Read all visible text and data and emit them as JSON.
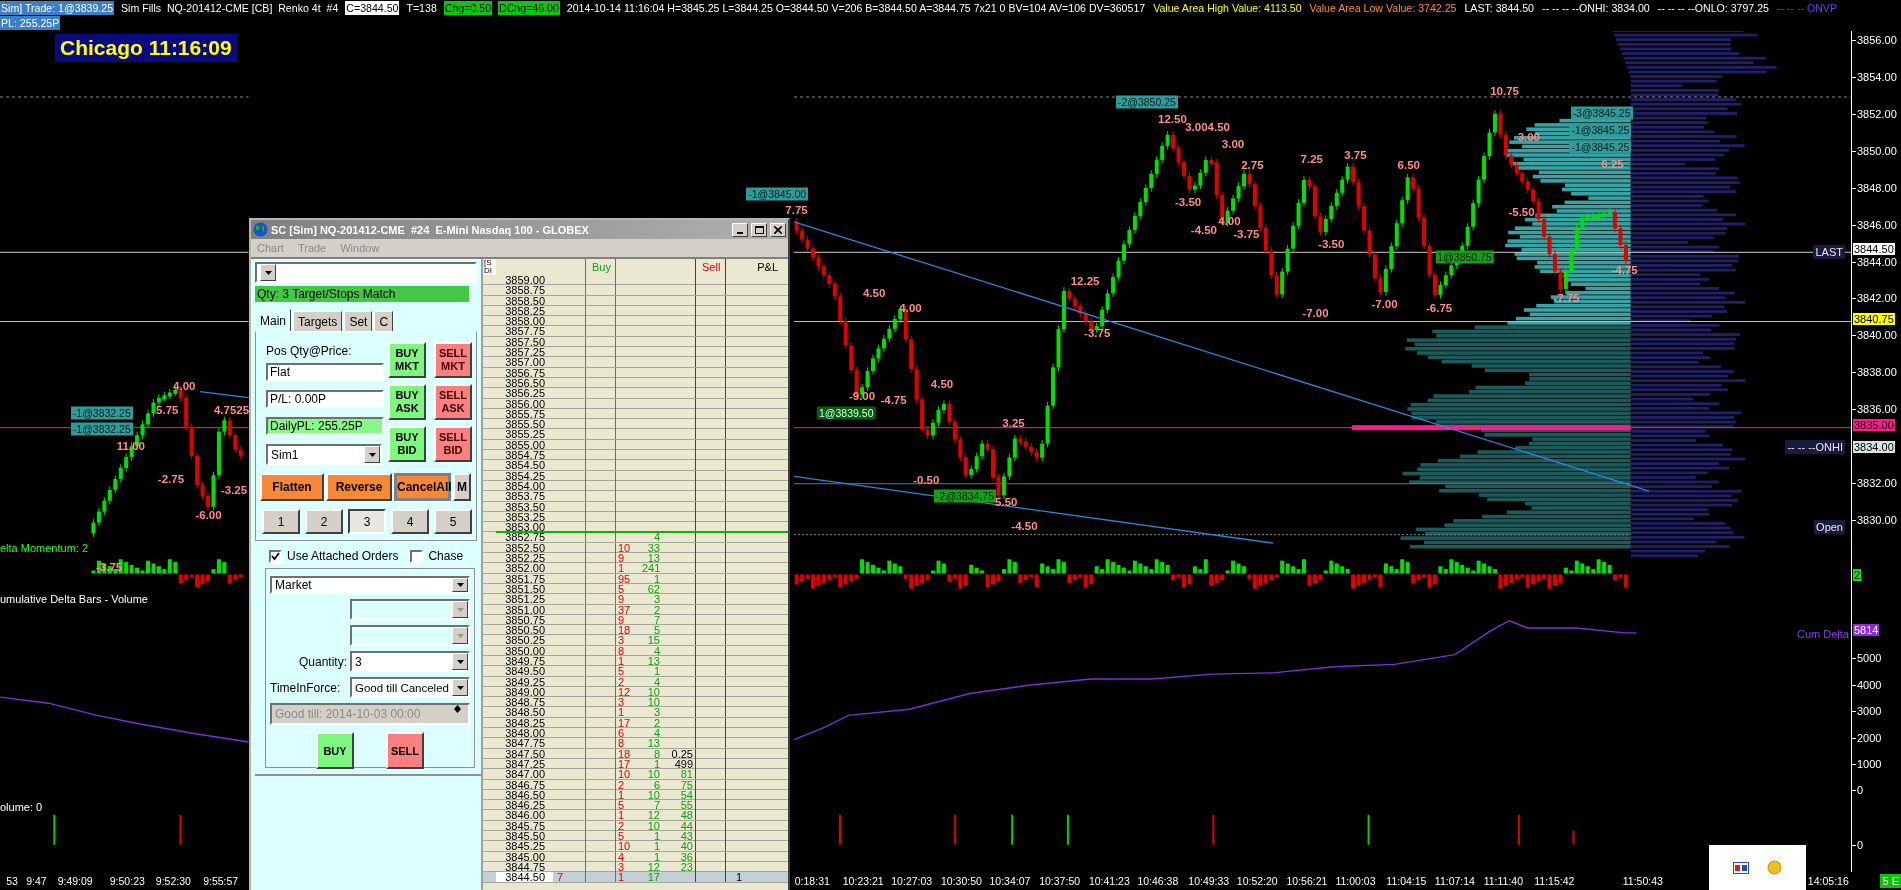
{
  "info_bar": {
    "line_1": [
      {
        "text": "Sim] Trade: 1@3839.25",
        "kind": "blue"
      },
      {
        "text": "Sim Fills  NQ-201412-CME [CB]  Renko 4t  #4",
        "kind": "plain"
      },
      {
        "text": "C=3844.50",
        "kind": "white"
      },
      {
        "text": "T=138",
        "kind": "plain"
      },
      {
        "text": "Chg=0.50",
        "kind": "green"
      },
      {
        "text": "DChg=46.00",
        "kind": "green"
      },
      {
        "text": "2014-10-14 11:16:04 H=3845.25 L=3844.25 O=3844.50 V=206 B=3844.50 A=3844.75 7x21 0 BV=104 AV=106 DV=360517",
        "kind": "plain"
      },
      {
        "text": "Value Area High Value: 4113.50",
        "kind": "yellow"
      },
      {
        "text": "Value Area Low Value: 3742.25",
        "kind": "orange"
      },
      {
        "text": "LAST: 3844.50",
        "kind": "plain"
      },
      {
        "text": "-- -- -- --ONHI: 3834.00",
        "kind": "plain"
      },
      {
        "text": "-- -- -- --ONLO: 3797.25",
        "kind": "plain"
      },
      {
        "text": "-- -- -- ONVP",
        "kind": "purple"
      }
    ],
    "line_2": [
      {
        "text": "PL: 255.25P",
        "kind": "blue"
      }
    ]
  },
  "clock": "Chicago 11:16:09",
  "chart": {
    "swing_labels": [
      "4.00",
      "5.75",
      "4.7525",
      "11.00",
      "-2.75",
      "-3.25",
      "-6.00",
      "-3.75",
      "7.75",
      "4.50",
      "4.00",
      "-9.00",
      "-4.75",
      "4.50",
      "3.25",
      "-0.50",
      "5.50",
      "-4.50",
      "12.25",
      "-3.75",
      "12.50",
      "3.004.50",
      "3.00",
      "2.75",
      "-3.50",
      "4.00",
      "-4.50",
      "-3.75",
      "7.25",
      "3.75",
      "6.50",
      "-3.50",
      "-7.00",
      "-7.00",
      "-6.75",
      "10.75",
      "3.00",
      "6.25",
      "-5.50",
      "-4.75",
      "-7.75"
    ],
    "order_tags": [
      {
        "text": "-1@3832.25",
        "kind": "sell"
      },
      {
        "text": "-1@3832.25",
        "kind": "sell"
      },
      {
        "text": "-1@3845.00",
        "kind": "sell"
      },
      {
        "text": "1@3839.50",
        "kind": "buy"
      },
      {
        "text": "-2@3834.75",
        "kind": "fill"
      },
      {
        "text": "-2@3850.25",
        "kind": "sell"
      },
      {
        "text": "1@3850.75",
        "kind": "fill"
      },
      {
        "text": "-3@3845.25",
        "kind": "sell"
      },
      {
        "text": "-1@3845.25",
        "kind": "sell"
      },
      {
        "text": "-1@3845.25",
        "kind": "sell"
      }
    ],
    "level_labels": [
      "LAST",
      "-- -- --ONHI",
      "Open"
    ],
    "pane_titles": [
      {
        "text": "elta Momentum: 2",
        "kind": "green"
      },
      {
        "text": "umulative Delta Bars - Volume",
        "kind": "white"
      },
      {
        "text": "olume: 0",
        "kind": "white"
      }
    ],
    "series_label": "Cum Delta"
  },
  "price_axis": {
    "ticks": [
      "3856.00",
      "3854.00",
      "3852.00",
      "3850.00",
      "3848.00",
      "3846.00",
      "3844.00",
      "3842.00",
      "3840.00",
      "3838.00",
      "3836.00",
      "3832.00",
      "3830.00"
    ],
    "markers": [
      {
        "text": "3844.50",
        "kind": "last"
      },
      {
        "text": "3840.75",
        "kind": "yellow"
      },
      {
        "text": "3835.00",
        "kind": "pink"
      },
      {
        "text": "3834.00",
        "kind": "onhi"
      }
    ]
  },
  "momentum_axis": {
    "marker": "2"
  },
  "cum_delta_axis": {
    "marker": "5814",
    "ticks": [
      "5000",
      "4000",
      "3000",
      "2000",
      "1000",
      "0"
    ]
  },
  "volume_axis": {
    "ticks": [
      "0"
    ]
  },
  "time_axis": {
    "labels": [
      "53",
      "9:47",
      "9:49:09",
      "9:50:23",
      "9:52:30",
      "9:55:57",
      "0:18:31",
      "10:23:21",
      "10:27:03",
      "10:30:50",
      "10:34:07",
      "10:37:50",
      "10:41:23",
      "10:46:38",
      "10:49:33",
      "10:52:20",
      "10:56:21",
      "11:00:03",
      "11:04:15",
      "11:07:14",
      "11:11:40",
      "11:15:42",
      "11:50:43",
      "14:05:16"
    ],
    "corner": "5 E"
  },
  "order_window": {
    "title": "SC [Sim] NQ-201412-CME  #24  E-Mini Nasdaq 100 - GLOBEX",
    "menu": [
      "Chart",
      "Trade",
      "Window"
    ],
    "status": "Qty: 3 Target/Stops Match",
    "tabs": [
      {
        "label": "Main",
        "selected": true
      },
      {
        "label": "Targets",
        "selected": false
      },
      {
        "label": "Set",
        "selected": false
      },
      {
        "label": "C",
        "selected": false
      }
    ],
    "position_label": "Pos Qty@Price:",
    "position": "Flat",
    "pl": "P/L: 0.00P",
    "daily_pl": "DailyPL: 255.25P",
    "account": "Sim1",
    "order_buttons": [
      {
        "text": "BUY MKT",
        "kind": "buy"
      },
      {
        "text": "SELL MKT",
        "kind": "sell"
      },
      {
        "text": "BUY ASK",
        "kind": "buy"
      },
      {
        "text": "SELL ASK",
        "kind": "sell"
      },
      {
        "text": "BUY BID",
        "kind": "buy"
      },
      {
        "text": "SELL BID",
        "kind": "sell"
      }
    ],
    "action_buttons": [
      {
        "text": "Flatten",
        "kind": "orange"
      },
      {
        "text": "Reverse",
        "kind": "orange"
      },
      {
        "text": "CancelAll",
        "kind": "framed"
      },
      {
        "text": "M",
        "kind": "plain"
      }
    ],
    "quantity_buttons": [
      {
        "label": "1",
        "selected": false
      },
      {
        "label": "2",
        "selected": false
      },
      {
        "label": "3",
        "selected": true
      },
      {
        "label": "4",
        "selected": false
      },
      {
        "label": "5",
        "selected": false
      }
    ],
    "checkboxes": [
      {
        "label": "Use Attached Orders",
        "checked": true
      },
      {
        "label": "Chase",
        "checked": false
      }
    ],
    "order_type": "Market",
    "quantity_label": "Quantity:",
    "quantity": "3",
    "tif_label": "TimeInForce:",
    "tif": "Good till Canceled",
    "good_till": "Good till: 2014-10-03 00:00",
    "submit_buttons": [
      {
        "text": "BUY",
        "kind": "buy"
      },
      {
        "text": "SELL",
        "kind": "sell"
      }
    ],
    "dom": {
      "header_fragments": [
        "[S",
        "DI"
      ],
      "columns": [
        {
          "text": "Buy",
          "kind": "buy"
        },
        {
          "text": "Sell",
          "kind": "sell"
        },
        {
          "text": "P&L",
          "kind": "pl"
        }
      ],
      "rows": [
        {
          "price": "3859.00",
          "current": false,
          "line_above": false
        },
        {
          "price": "3858.75",
          "current": false,
          "line_above": false
        },
        {
          "price": "3858.50",
          "current": false,
          "line_above": false
        },
        {
          "price": "3858.25",
          "current": false,
          "line_above": false
        },
        {
          "price": "3858.00",
          "current": false,
          "line_above": false
        },
        {
          "price": "3857.75",
          "current": false,
          "line_above": false
        },
        {
          "price": "3857.50",
          "current": false,
          "line_above": false
        },
        {
          "price": "3857.25",
          "current": false,
          "line_above": false
        },
        {
          "price": "3857.00",
          "current": false,
          "line_above": false
        },
        {
          "price": "3856.75",
          "current": false,
          "line_above": false
        },
        {
          "price": "3856.50",
          "current": false,
          "line_above": false
        },
        {
          "price": "3856.25",
          "current": false,
          "line_above": false
        },
        {
          "price": "3856.00",
          "current": false,
          "line_above": false
        },
        {
          "price": "3855.75",
          "current": false,
          "line_above": false
        },
        {
          "price": "3855.50",
          "current": false,
          "line_above": false
        },
        {
          "price": "3855.25",
          "current": false,
          "line_above": false
        },
        {
          "price": "3855.00",
          "current": false,
          "line_above": false
        },
        {
          "price": "3854.75",
          "current": false,
          "line_above": false
        },
        {
          "price": "3854.50",
          "current": false,
          "line_above": false
        },
        {
          "price": "3854.25",
          "current": false,
          "line_above": false
        },
        {
          "price": "3854.00",
          "current": false,
          "line_above": false
        },
        {
          "price": "3853.75",
          "current": false,
          "line_above": false
        },
        {
          "price": "3853.50",
          "current": false,
          "line_above": false
        },
        {
          "price": "3853.25",
          "current": false,
          "line_above": false
        },
        {
          "price": "3853.00",
          "current": false,
          "line_above": false
        },
        {
          "price": "3852.75",
          "column_5": "4",
          "current": false,
          "line_above": true
        },
        {
          "price": "3852.50",
          "column_4": "10",
          "column_5": "33",
          "current": false,
          "line_above": false
        },
        {
          "price": "3852.25",
          "column_4": "9",
          "column_5": "13",
          "current": false,
          "line_above": false
        },
        {
          "price": "3852.00",
          "column_4": "1",
          "column_5": "241",
          "current": false,
          "line_above": false
        },
        {
          "price": "3851.75",
          "column_4": "95",
          "column_5": "1",
          "current": false,
          "line_above": false
        },
        {
          "price": "3851.50",
          "column_4": "5",
          "column_5": "62",
          "current": false,
          "line_above": false
        },
        {
          "price": "3851.25",
          "column_4": "9",
          "column_5": "3",
          "current": false,
          "line_above": false
        },
        {
          "price": "3851.00",
          "column_4": "37",
          "column_5": "2",
          "current": false,
          "line_above": false
        },
        {
          "price": "3850.75",
          "column_4": "9",
          "column_5": "7",
          "current": false,
          "line_above": false
        },
        {
          "price": "3850.50",
          "column_4": "18",
          "column_5": "5",
          "current": false,
          "line_above": false
        },
        {
          "price": "3850.25",
          "column_4": "3",
          "column_5": "15",
          "current": false,
          "line_above": false
        },
        {
          "price": "3850.00",
          "column_4": "8",
          "column_5": "4",
          "current": false,
          "line_above": false
        },
        {
          "price": "3849.75",
          "column_4": "1",
          "column_5": "13",
          "current": false,
          "line_above": false
        },
        {
          "price": "3849.50",
          "column_4": "5",
          "column_5": "1",
          "current": false,
          "line_above": false
        },
        {
          "price": "3849.25",
          "column_4": "2",
          "column_5": "4",
          "current": false,
          "line_above": false
        },
        {
          "price": "3849.00",
          "column_4": "12",
          "column_5": "10",
          "current": false,
          "line_above": false
        },
        {
          "price": "3848.75",
          "column_4": "3",
          "column_5": "10",
          "current": false,
          "line_above": false
        },
        {
          "price": "3848.50",
          "column_4": "1",
          "column_5": "3",
          "current": false,
          "line_above": false
        },
        {
          "price": "3848.25",
          "column_4": "17",
          "column_5": "2",
          "current": false,
          "line_above": false
        },
        {
          "price": "3848.00",
          "column_4": "6",
          "column_5": "4",
          "current": false,
          "line_above": false
        },
        {
          "price": "3847.75",
          "column_4": "8",
          "column_5": "13",
          "current": false,
          "line_above": false
        },
        {
          "price": "3847.50",
          "column_4": "18",
          "column_5": "8",
          "column_6": {
            "text": "0.25",
            "kind": "order"
          },
          "current": false,
          "line_above": false
        },
        {
          "price": "3847.25",
          "column_4": "17",
          "column_5": "1",
          "column_6": {
            "text": "499",
            "kind": "order"
          },
          "current": false,
          "line_above": false
        },
        {
          "price": "3847.00",
          "column_4": "10",
          "column_5": "10",
          "column_6": {
            "text": "81",
            "kind": "volume"
          },
          "current": false,
          "line_above": false
        },
        {
          "price": "3846.75",
          "column_4": "2",
          "column_5": "6",
          "column_6": {
            "text": "75",
            "kind": "volume"
          },
          "current": false,
          "line_above": false
        },
        {
          "price": "3846.50",
          "column_4": "1",
          "column_5": "10",
          "column_6": {
            "text": "54",
            "kind": "volume"
          },
          "current": false,
          "line_above": false
        },
        {
          "price": "3846.25",
          "column_4": "5",
          "column_5": "7",
          "column_6": {
            "text": "55",
            "kind": "volume"
          },
          "current": false,
          "line_above": false
        },
        {
          "price": "3846.00",
          "column_4": "1",
          "column_5": "12",
          "column_6": {
            "text": "48",
            "kind": "volume"
          },
          "current": false,
          "line_above": false
        },
        {
          "price": "3845.75",
          "column_4": "2",
          "column_5": "10",
          "column_6": {
            "text": "44",
            "kind": "volume"
          },
          "current": false,
          "line_above": false
        },
        {
          "price": "3845.50",
          "column_4": "5",
          "column_5": "1",
          "column_6": {
            "text": "43",
            "kind": "volume"
          },
          "current": false,
          "line_above": false
        },
        {
          "price": "3845.25",
          "column_4": "10",
          "column_5": "1",
          "column_6": {
            "text": "40",
            "kind": "volume"
          },
          "current": false,
          "line_above": false
        },
        {
          "price": "3845.00",
          "column_4": "4",
          "column_5": "1",
          "column_6": {
            "text": "36",
            "kind": "volume"
          },
          "current": false,
          "line_above": false
        },
        {
          "price": "3844.75",
          "column_4": "3",
          "column_5": "12",
          "column_6": {
            "text": "23",
            "kind": "volume"
          },
          "current": false,
          "line_above": false
        },
        {
          "price": "3844.50",
          "column_2": "7",
          "column_4": "1",
          "column_5": "17",
          "pl": "1",
          "current": true,
          "line_above": false
        }
      ]
    }
  }
}
